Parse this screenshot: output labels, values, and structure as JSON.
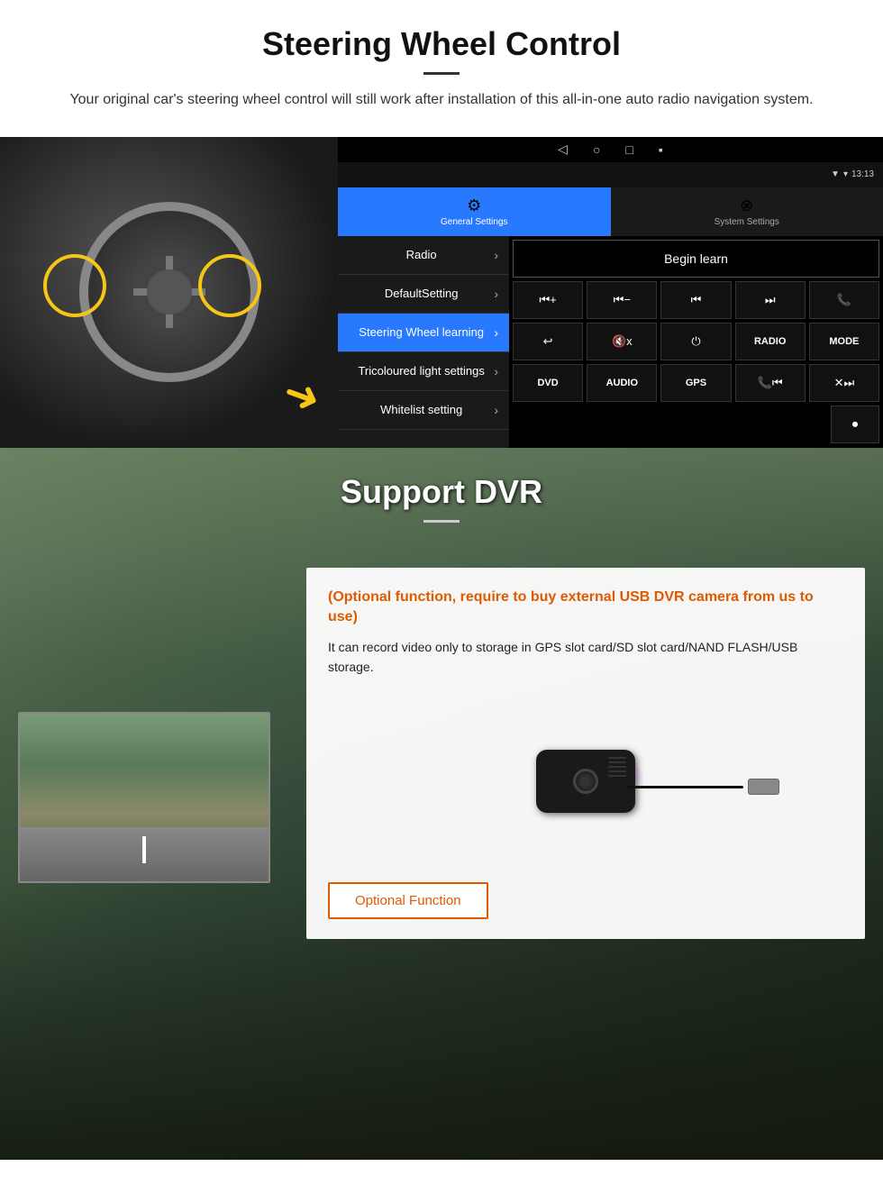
{
  "section1": {
    "title": "Steering Wheel Control",
    "description": "Your original car's steering wheel control will still work after installation of this all-in-one auto radio navigation system.",
    "android_ui": {
      "statusbar": {
        "time": "13:13",
        "signal_icon": "▼",
        "wifi_icon": "▾",
        "battery_icon": "▮"
      },
      "nav_buttons": [
        "◁",
        "○",
        "□",
        "▪"
      ],
      "tabs": [
        {
          "icon": "⚙",
          "label": "General Settings",
          "active": true
        },
        {
          "icon": "⊗",
          "label": "System Settings",
          "active": false
        }
      ],
      "menu_items": [
        {
          "label": "Radio",
          "active": false
        },
        {
          "label": "DefaultSetting",
          "active": false
        },
        {
          "label": "Steering Wheel learning",
          "active": true
        },
        {
          "label": "Tricoloured light settings",
          "active": false
        },
        {
          "label": "Whitelist setting",
          "active": false
        }
      ],
      "begin_learn_label": "Begin learn",
      "control_buttons": [
        [
          "⏮+",
          "⏮−",
          "⏭⏭",
          "⏩⏩",
          "📞"
        ],
        [
          "↩",
          "🔇x",
          "⏻",
          "RADIO",
          "MODE"
        ],
        [
          "DVD",
          "AUDIO",
          "GPS",
          "📞⏭",
          "✕⏩"
        ],
        [
          "⏺"
        ]
      ]
    }
  },
  "section2": {
    "title": "Support DVR",
    "optional_text": "(Optional function, require to buy external USB DVR camera from us to use)",
    "description": "It can record video only to storage in GPS slot card/SD slot card/NAND FLASH/USB storage.",
    "optional_button_label": "Optional Function"
  }
}
